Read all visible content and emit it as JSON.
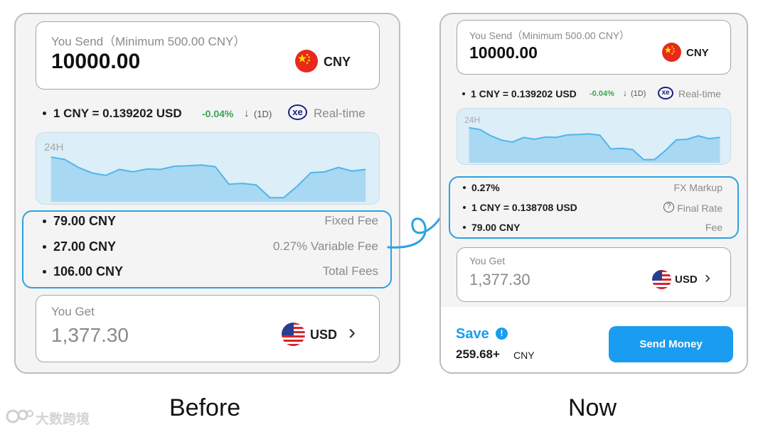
{
  "before": {
    "send": {
      "label": "You Send（Minimum 500.00 CNY）",
      "amount": "10000.00",
      "currency": "CNY"
    },
    "rate": {
      "text": "1 CNY = 0.139202 USD",
      "change": "-0.04%",
      "change_arrow": "↓",
      "period": "(1D)",
      "provider_logo": "xe",
      "mode": "Real-time"
    },
    "chart_label": "24H",
    "fees": [
      {
        "value": "79.00 CNY",
        "label": "Fixed Fee"
      },
      {
        "value": "27.00 CNY",
        "label": "0.27% Variable Fee"
      },
      {
        "value": "106.00 CNY",
        "label": "Total Fees"
      }
    ],
    "get": {
      "label": "You Get",
      "amount": "1,377.30",
      "currency": "USD",
      "chevron": "›"
    }
  },
  "now": {
    "send": {
      "label": "You Send（Minimum 500.00 CNY）",
      "amount": "10000.00",
      "currency": "CNY"
    },
    "rate": {
      "text": "1 CNY = 0.139202 USD",
      "change": "-0.04%",
      "change_arrow": "↓",
      "period": "(1D)",
      "provider_logo": "xe",
      "mode": "Real-time"
    },
    "chart_label": "24H",
    "fees": [
      {
        "value": "0.27%",
        "label": "FX Markup",
        "icon": ""
      },
      {
        "value": "1 CNY = 0.138708 USD",
        "label": "Final Rate",
        "icon": "?"
      },
      {
        "value": "79.00 CNY",
        "label": "Fee",
        "icon": ""
      }
    ],
    "get": {
      "label": "You Get",
      "amount": "1,377.30",
      "currency": "USD",
      "chevron": "›"
    },
    "save": {
      "label": "Save",
      "info_icon": "!",
      "amount": "259.68+",
      "currency": "CNY"
    },
    "send_button": "Send Money"
  },
  "captions": {
    "before": "Before",
    "now": "Now"
  },
  "watermark": "大数跨境",
  "chart_data": [
    {
      "type": "area",
      "title": "24H",
      "x": [
        0,
        1,
        2,
        3,
        4,
        5,
        6,
        7,
        8,
        9,
        10,
        11,
        12,
        13,
        14,
        15,
        16,
        17,
        18,
        19,
        20,
        21,
        22,
        23
      ],
      "series": [
        {
          "values": [
            0.139262,
            0.139256,
            0.139236,
            0.139222,
            0.139216,
            0.139231,
            0.139225,
            0.139232,
            0.139231,
            0.139239,
            0.13924,
            0.139242,
            0.139238,
            0.139194,
            0.139196,
            0.139192,
            0.13916,
            0.13916,
            0.139189,
            0.139223,
            0.139225,
            0.139236,
            0.139227,
            0.139231
          ]
        }
      ],
      "ylim": [
        0.13915,
        0.13929
      ]
    }
  ],
  "colors": {
    "accent": "#2aa3e0",
    "button": "#1a9cf0",
    "save": "#1a9cf0",
    "positive": "#38a653",
    "chart_fill": "#a9d8f2",
    "chart_line": "#4fb6ea"
  }
}
